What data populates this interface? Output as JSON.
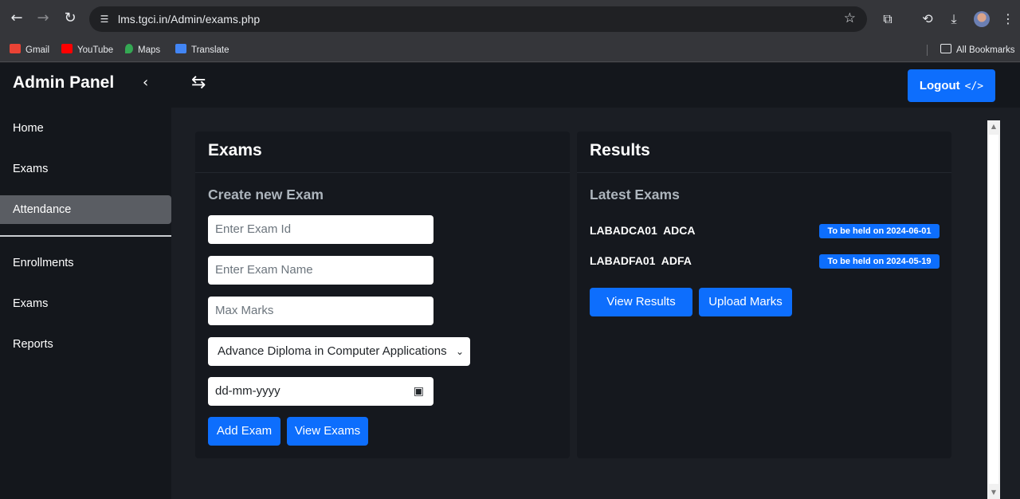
{
  "browser": {
    "url": "lms.tgci.in/Admin/exams.php",
    "bookmarks": [
      {
        "label": "Gmail",
        "icon": "gmail-icon",
        "color": "#ea4335"
      },
      {
        "label": "YouTube",
        "icon": "youtube-icon",
        "color": "#ff0000"
      },
      {
        "label": "Maps",
        "icon": "maps-icon",
        "color": "#34a853"
      },
      {
        "label": "Translate",
        "icon": "translate-icon",
        "color": "#4285f4"
      }
    ],
    "all_bookmarks_label": "All Bookmarks"
  },
  "sidebar": {
    "title": "Admin Panel",
    "items": [
      {
        "label": "Home"
      },
      {
        "label": "Exams"
      },
      {
        "label": "Attendance",
        "active": true
      },
      {
        "label": "Enrollments"
      },
      {
        "label": "Exams"
      },
      {
        "label": "Reports"
      }
    ]
  },
  "header": {
    "logout_label": "Logout",
    "logout_icon": "</>"
  },
  "exams_card": {
    "title": "Exams",
    "subtitle": "Create new Exam",
    "exam_id_placeholder": "Enter Exam Id",
    "exam_name_placeholder": "Enter Exam Name",
    "max_marks_placeholder": "Max Marks",
    "course_selected": "Advance Diploma in Computer Applications",
    "date_placeholder": "dd-mm-yyyy",
    "add_label": "Add Exam",
    "view_label": "View Exams"
  },
  "results_card": {
    "title": "Results",
    "subtitle": "Latest Exams",
    "exams": [
      {
        "code": "LABADCA01",
        "course": "ADCA",
        "badge": "To be held on 2024-06-01"
      },
      {
        "code": "LABADFA01",
        "course": "ADFA",
        "badge": "To be held on 2024-05-19"
      }
    ],
    "view_results_label": "View Results",
    "upload_marks_label": "Upload Marks"
  },
  "colors": {
    "accent": "#0d6efd",
    "sidebar_bg": "#14171c",
    "page_bg": "#1b1e24",
    "card_bg": "#15181e"
  }
}
